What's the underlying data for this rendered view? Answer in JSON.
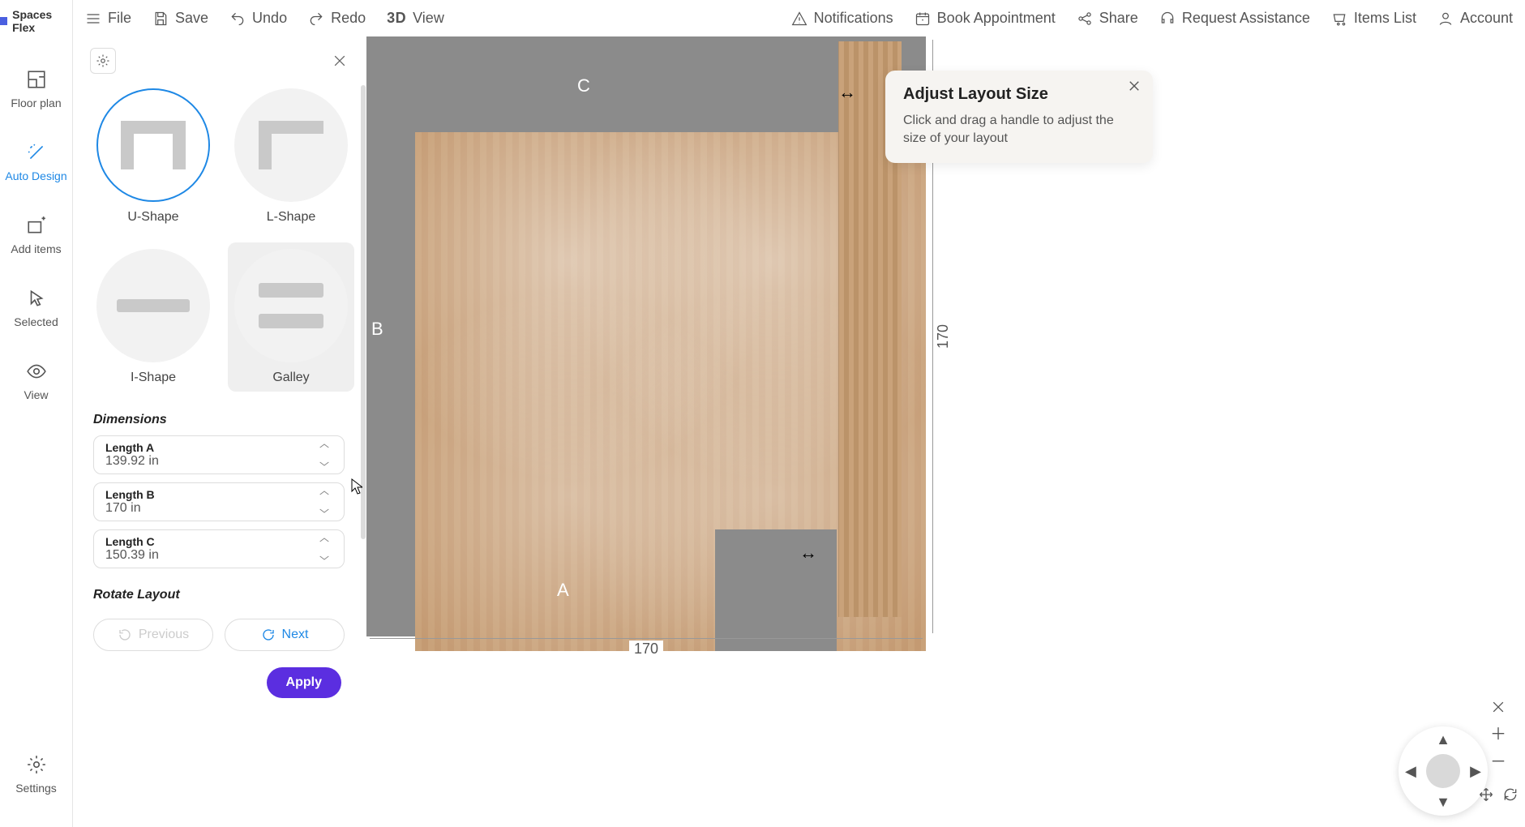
{
  "brand": "Spaces Flex",
  "topbar": {
    "file": "File",
    "save": "Save",
    "undo": "Undo",
    "redo": "Redo",
    "view3d_prefix": "3D",
    "view3d": "View",
    "notifications": "Notifications",
    "book": "Book Appointment",
    "share": "Share",
    "request": "Request Assistance",
    "items": "Items List",
    "account": "Account"
  },
  "rail": {
    "floorplan": "Floor plan",
    "autodesign": "Auto Design",
    "additems": "Add items",
    "selected": "Selected",
    "view": "View",
    "settings": "Settings"
  },
  "shapes": {
    "u": "U-Shape",
    "l": "L-Shape",
    "i": "I-Shape",
    "galley": "Galley"
  },
  "sections": {
    "dimensions": "Dimensions",
    "rotate": "Rotate Layout"
  },
  "dimensions": {
    "a_label": "Length A",
    "a_value": "139.92 in",
    "b_label": "Length B",
    "b_value": "170 in",
    "c_label": "Length C",
    "c_value": "150.39 in"
  },
  "rotate": {
    "prev": "Previous",
    "next": "Next"
  },
  "apply": "Apply",
  "canvas": {
    "labelA": "A",
    "labelB": "B",
    "labelC": "C",
    "dim_right": "170",
    "dim_bottom": "170"
  },
  "popover": {
    "title": "Adjust Layout Size",
    "body": "Click and drag a handle to adjust the size of your layout"
  }
}
